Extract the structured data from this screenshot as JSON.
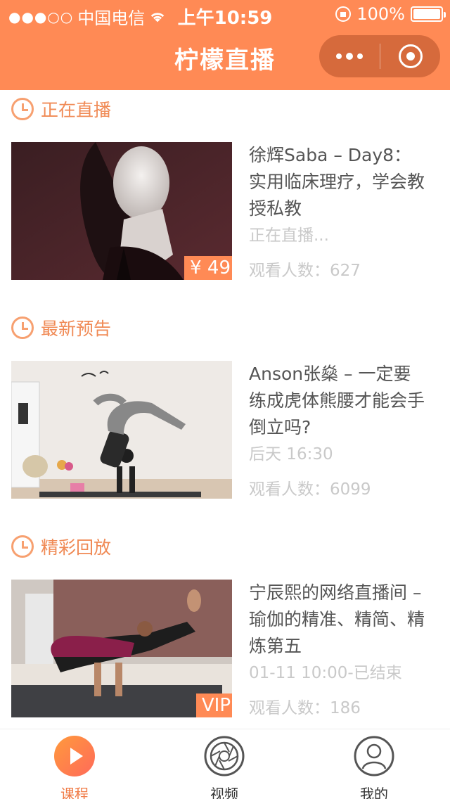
{
  "status_bar": {
    "signal": "●●●○○",
    "carrier": "中国电信",
    "time": "上午10:59",
    "battery": "100%"
  },
  "nav": {
    "title": "柠檬直播"
  },
  "sections": [
    {
      "title": "正在直播",
      "card": {
        "title": "徐辉Saba – Day8：实用临床理疗，学会教授私教",
        "status": "正在直播...",
        "views": "观看人数：627",
        "badge": "¥ 49"
      }
    },
    {
      "title": "最新预告",
      "card": {
        "title": "Anson张燊 – 一定要练成虎体熊腰才能会手倒立吗?",
        "status": "后天 16:30",
        "views": "观看人数：6099",
        "badge": ""
      }
    },
    {
      "title": "精彩回放",
      "card": {
        "title": "宁辰熙的网络直播间 – 瑜伽的精准、精简、精炼第五",
        "status": "01-11 10:00-已结束",
        "views": "观看人数：186",
        "badge": "VIP"
      }
    }
  ],
  "tabbar": {
    "items": [
      {
        "label": "课程",
        "icon": "play-icon",
        "active": true
      },
      {
        "label": "视频",
        "icon": "camera-aperture-icon",
        "active": false
      },
      {
        "label": "我的",
        "icon": "user-icon",
        "active": false
      }
    ]
  },
  "colors": {
    "accent": "#ff8a55",
    "section_title": "#f08a55",
    "muted_text": "#c9c9c9"
  }
}
